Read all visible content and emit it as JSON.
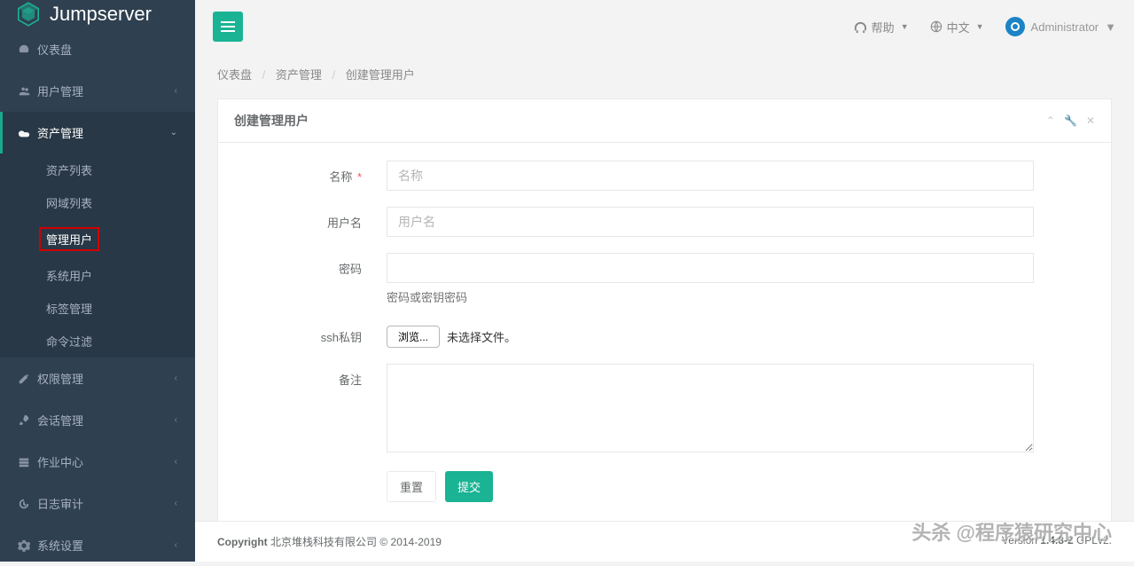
{
  "brand": "Jumpserver",
  "topbar": {
    "help": "帮助",
    "language": "中文",
    "user": "Administrator"
  },
  "breadcrumb": {
    "items": [
      "仪表盘",
      "资产管理",
      "创建管理用户"
    ]
  },
  "sidebar": {
    "items": [
      {
        "label": "仪表盘",
        "icon": "dashboard"
      },
      {
        "label": "用户管理",
        "icon": "users",
        "arrow": "left"
      },
      {
        "label": "资产管理",
        "icon": "asset",
        "arrow": "down",
        "active": true,
        "sub": [
          {
            "label": "资产列表"
          },
          {
            "label": "网域列表"
          },
          {
            "label": "管理用户",
            "active": true
          },
          {
            "label": "系统用户"
          },
          {
            "label": "标签管理"
          },
          {
            "label": "命令过滤"
          }
        ]
      },
      {
        "label": "权限管理",
        "icon": "perm",
        "arrow": "left"
      },
      {
        "label": "会话管理",
        "icon": "session",
        "arrow": "left"
      },
      {
        "label": "作业中心",
        "icon": "job",
        "arrow": "left"
      },
      {
        "label": "日志审计",
        "icon": "audit",
        "arrow": "left"
      },
      {
        "label": "系统设置",
        "icon": "settings",
        "arrow": "left"
      }
    ]
  },
  "panel": {
    "title": "创建管理用户"
  },
  "form": {
    "name": {
      "label": "名称",
      "placeholder": "名称",
      "required": true
    },
    "username": {
      "label": "用户名",
      "placeholder": "用户名"
    },
    "password": {
      "label": "密码",
      "help": "密码或密钥密码"
    },
    "ssh_key": {
      "label": "ssh私钥",
      "browse": "浏览...",
      "status": "未选择文件。"
    },
    "comment": {
      "label": "备注"
    },
    "reset": "重置",
    "submit": "提交"
  },
  "footer": {
    "copyright_label": "Copyright",
    "company": "北京堆栈科技有限公司 © 2014-2019",
    "version_label": "Version",
    "version": "1.4.8-2",
    "license": "GPLv2."
  },
  "watermark": "头杀 @程序猿研究中心"
}
